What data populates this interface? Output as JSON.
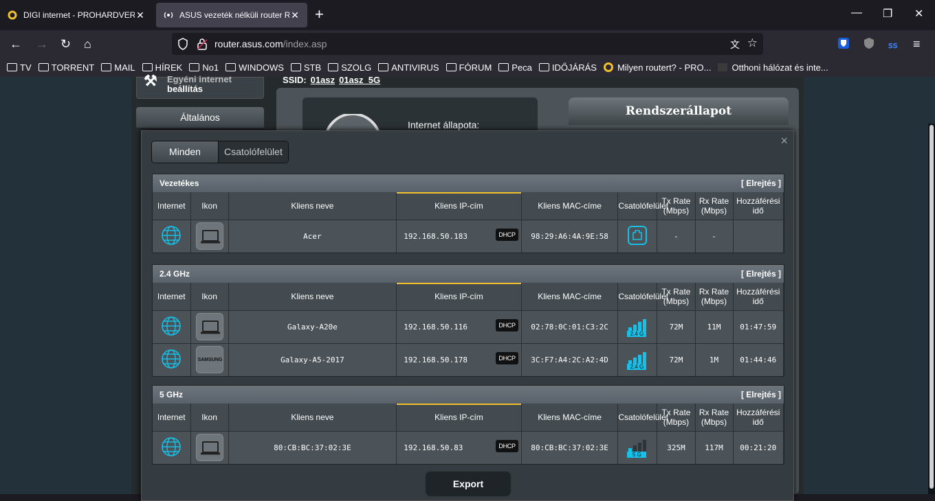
{
  "browser": {
    "tabs": [
      {
        "title": "DIGI internet - PROHARDVER! H"
      },
      {
        "title": "ASUS vezeték nélküli router RT-A"
      }
    ],
    "new_tab": "+",
    "url_host": "router.asus.com",
    "url_path": "/index.asp",
    "bookmarks": [
      "TV",
      "TORRENT",
      "MAIL",
      "HÍREK",
      "No1",
      "WINDOWS",
      "STB",
      "SZOLG",
      "ANTIVIRUS",
      "FÓRUM",
      "Peca",
      "IDŐJÁRÁS",
      "Milyen routert? - PRO...",
      "Otthoni hálózat és inte..."
    ]
  },
  "router": {
    "menu_line1": "Egyéni internet",
    "menu_line2": "beállítás",
    "altalanos": "Általános",
    "ssid_label": "SSID:",
    "ssid1": "01asz",
    "ssid2": "01asz_5G",
    "internet_status": "Internet állapota:",
    "system_status": "Rendszerállapot"
  },
  "modal": {
    "close": "×",
    "seg_all": "Minden",
    "seg_iface": "Csatolófelület",
    "hide": "[ Elrejtés ]",
    "export": "Export",
    "columns": {
      "internet": "Internet",
      "icon": "Ikon",
      "name": "Kliens neve",
      "ip": "Kliens IP-cím",
      "mac": "Kliens MAC-címe",
      "iface": "Csatolófelület",
      "tx1": "Tx Rate",
      "tx2": "(Mbps)",
      "rx1": "Rx Rate",
      "rx2": "(Mbps)",
      "time1": "Hozzáférési",
      "time2": "idő"
    },
    "dhcp": "DHCP",
    "groups": [
      {
        "title": "Vezetékes",
        "rows": [
          {
            "name": "Acer",
            "ip": "192.168.50.183",
            "mac": "98:29:A6:4A:9E:58",
            "iface": "lan",
            "tx": "-",
            "rx": "-",
            "time": "",
            "device": "laptop"
          }
        ]
      },
      {
        "title": "2.4 GHz",
        "rows": [
          {
            "name": "Galaxy-A20e",
            "ip": "192.168.50.116",
            "mac": "02:78:0C:01:C3:2C",
            "iface": "2.4 G",
            "tx": "72M",
            "rx": "11M",
            "time": "01:47:59",
            "device": "laptop"
          },
          {
            "name": "Galaxy-A5-2017",
            "ip": "192.168.50.178",
            "mac": "3C:F7:A4:2C:A2:4D",
            "iface": "2.4 G",
            "tx": "72M",
            "rx": "1M",
            "time": "01:44:46",
            "device": "samsung"
          }
        ]
      },
      {
        "title": "5 GHz",
        "rows": [
          {
            "name": "80:CB:BC:37:02:3E",
            "ip": "192.168.50.83",
            "mac": "80:CB:BC:37:02:3E",
            "iface": "5 G",
            "tx": "325M",
            "rx": "117M",
            "time": "00:21:20",
            "device": "laptop"
          }
        ]
      }
    ],
    "samsung_label": "SAMSUNG"
  }
}
